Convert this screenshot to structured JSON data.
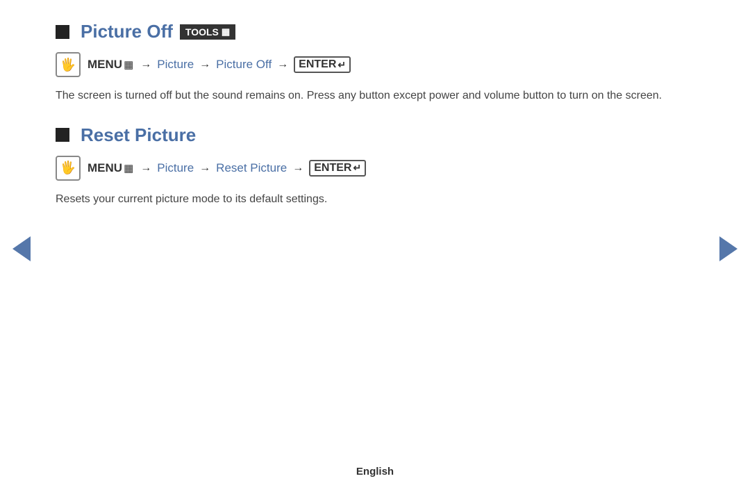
{
  "sections": [
    {
      "id": "picture-off",
      "title": "Picture Off",
      "hasBadge": true,
      "badge": "TOOLS",
      "menuPath": {
        "keyword": "MENU",
        "menuSymbol": "⊞",
        "steps": [
          "Picture",
          "Picture Off"
        ],
        "enter": "ENTER"
      },
      "description": "The screen is turned off but the sound remains on. Press any button except power and volume button to turn on the screen."
    },
    {
      "id": "reset-picture",
      "title": "Reset Picture",
      "hasBadge": false,
      "menuPath": {
        "keyword": "MENU",
        "menuSymbol": "⊞",
        "steps": [
          "Picture",
          "Reset Picture"
        ],
        "enter": "ENTER"
      },
      "description": "Resets your current picture mode to its default settings."
    }
  ],
  "navigation": {
    "prev_label": "◀",
    "next_label": "▶"
  },
  "footer": {
    "language": "English"
  }
}
